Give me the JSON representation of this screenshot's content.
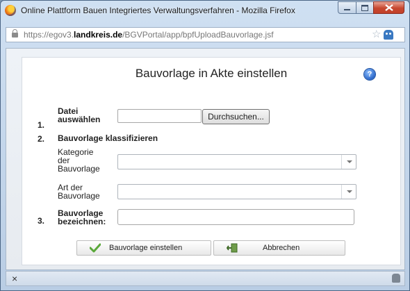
{
  "window": {
    "title": "Online Plattform Bauen Integriertes Verwaltungsverfahren - Mozilla Firefox"
  },
  "address_bar": {
    "url_prefix": "https://egov3.",
    "url_host": "landkreis.de",
    "url_path": "/BGVPortal/app/bpfUploadBauvorlage.jsf"
  },
  "form": {
    "heading": "Bauvorlage in Akte einstellen",
    "help_icon": "?",
    "step1_num": "1.",
    "step1_label_line1": "Datei",
    "step1_label_line2": "auswählen",
    "file_value": "",
    "browse_label": "Durchsuchen...",
    "step2_num": "2.",
    "step2_label": "Bauvorlage klassifizieren",
    "kategorie_label_line1": "Kategorie",
    "kategorie_label_line2": "der",
    "kategorie_label_line3": "Bauvorlage",
    "kategorie_selected": "",
    "art_label_line1": "Art der",
    "art_label_line2": "Bauvorlage",
    "art_selected": "",
    "step3_num": "3.",
    "step3_label_line1": "Bauvorlage",
    "step3_label_line2": "bezeichnen:",
    "name_value": "",
    "submit_label": "Bauvorlage einstellen",
    "cancel_label": "Abbrechen"
  },
  "statusbar": {
    "close_glyph": "×"
  }
}
